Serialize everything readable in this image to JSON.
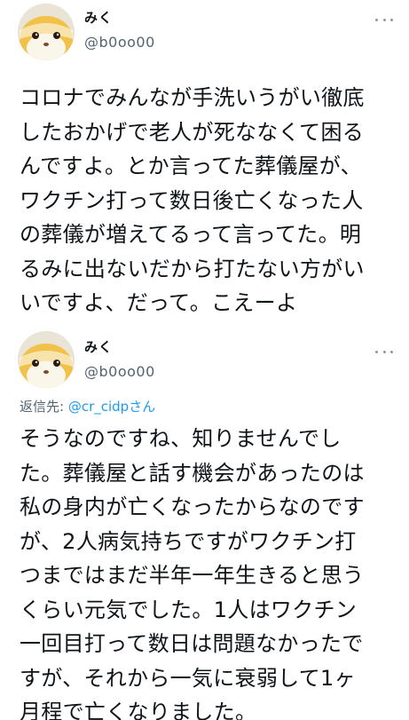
{
  "tweets": [
    {
      "username": "みく",
      "handle": "@b0oo00",
      "body": "コロナでみんなが手洗いうがい徹底\nしたおかげで老人が死ななくて困る\nんですよ。とか言ってた葬儀屋が、\nワクチン打って数日後亡くなった人\nの葬儀が増えてるって言ってた。明\nるみに出ないだから打たない方がい\nいですよ、だって。こえーよ",
      "avatar_icon": "guinea-pig-avatar",
      "more_icon": "more-horizontal-icon"
    },
    {
      "username": "みく",
      "handle": "@b0oo00",
      "reply_prefix": "返信先: ",
      "reply_mention": "@cr_cidpさん",
      "body": "そうなのですね、知りませんでし\nた。葬儀屋と話す機会があったのは\n私の身内が亡くなったからなのです\nが、2人病気持ちですがワクチン打\nつまではまだ半年一年生きると思う\nくらい元気でした。1人はワクチン\n一回目打って数日は問題なかったで\nすが、それから一気に衰弱して1ヶ\n月程で亡くなりました。",
      "avatar_icon": "guinea-pig-avatar",
      "more_icon": "more-horizontal-icon"
    }
  ],
  "colors": {
    "text": "#0f1419",
    "secondary": "#536471",
    "link": "#1d9bf0",
    "background": "#ffffff"
  }
}
